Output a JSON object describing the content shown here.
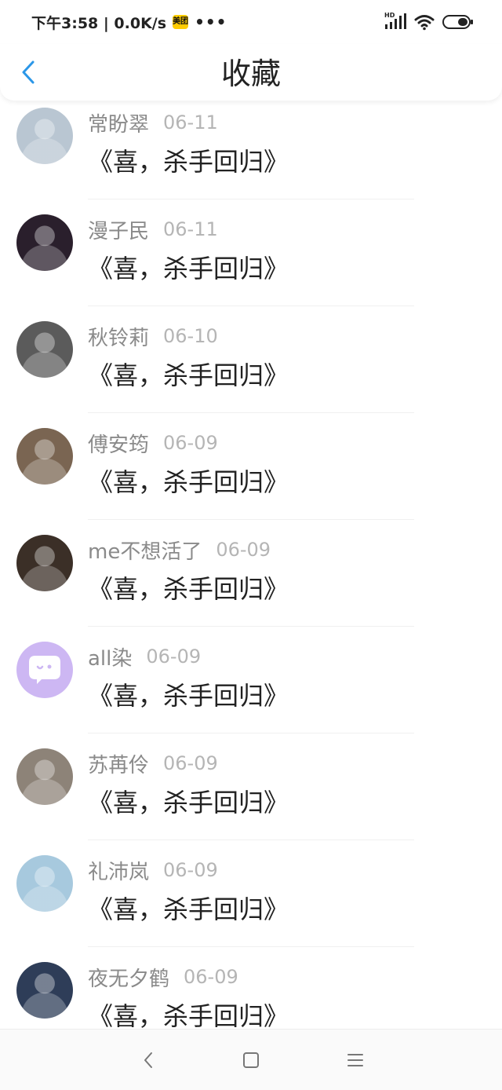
{
  "status_bar": {
    "time_speed": "下午3:58 | 0.0K/s",
    "app_badge": "美团",
    "more": "•••",
    "signal_label": "HD"
  },
  "header": {
    "title": "收藏",
    "accent_color": "#2b97e8"
  },
  "items": [
    {
      "name": "常盼翠",
      "date": "06-11",
      "title": "《喜，杀手回归》",
      "avatar_color": "#b9c6d2"
    },
    {
      "name": "漫子民",
      "date": "06-11",
      "title": "《喜，杀手回归》",
      "avatar_color": "#2a1f2c"
    },
    {
      "name": "秋铃莉",
      "date": "06-10",
      "title": "《喜，杀手回归》",
      "avatar_color": "#5b5b5b"
    },
    {
      "name": "傅安筠",
      "date": "06-09",
      "title": "《喜，杀手回归》",
      "avatar_color": "#7a6552"
    },
    {
      "name": "me不想活了",
      "date": "06-09",
      "title": "《喜，杀手回归》",
      "avatar_color": "#3b2f27"
    },
    {
      "name": "all染",
      "date": "06-09",
      "title": "《喜，杀手回归》",
      "avatar_color": "#cdb7f3"
    },
    {
      "name": "苏苒伶",
      "date": "06-09",
      "title": "《喜，杀手回归》",
      "avatar_color": "#8d8378"
    },
    {
      "name": "礼沛岚",
      "date": "06-09",
      "title": "《喜，杀手回归》",
      "avatar_color": "#a7c9de"
    },
    {
      "name": "夜无夕鹤",
      "date": "06-09",
      "title": "《喜，杀手回归》",
      "avatar_color": "#2e3d58"
    }
  ]
}
